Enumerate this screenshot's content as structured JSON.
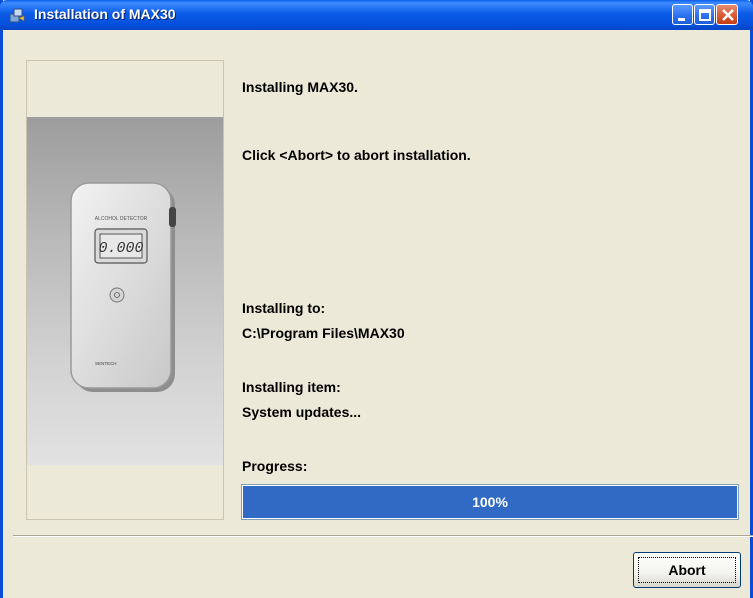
{
  "window": {
    "title": "Installation of MAX30",
    "controls": [
      "minimize",
      "maximize",
      "close"
    ]
  },
  "device": {
    "display_reading": "0.000",
    "top_label": "ALCOHOL DETECTOR",
    "brand_label": "SENTECH"
  },
  "content": {
    "heading": "Installing MAX30.",
    "instruction": "Click <Abort> to abort installation.",
    "install_to_label": "Installing to:",
    "install_path": "C:\\Program Files\\MAX30",
    "install_item_label": "Installing item:",
    "install_item": "System updates...",
    "progress_label": "Progress:"
  },
  "progress": {
    "value": 1.0,
    "text": "100%"
  },
  "buttons": {
    "abort_label": "Abort"
  },
  "colors": {
    "titlebar": "#0A5FEA",
    "progress_fill": "#316AC5",
    "window_bg": "#ECE9D8"
  }
}
